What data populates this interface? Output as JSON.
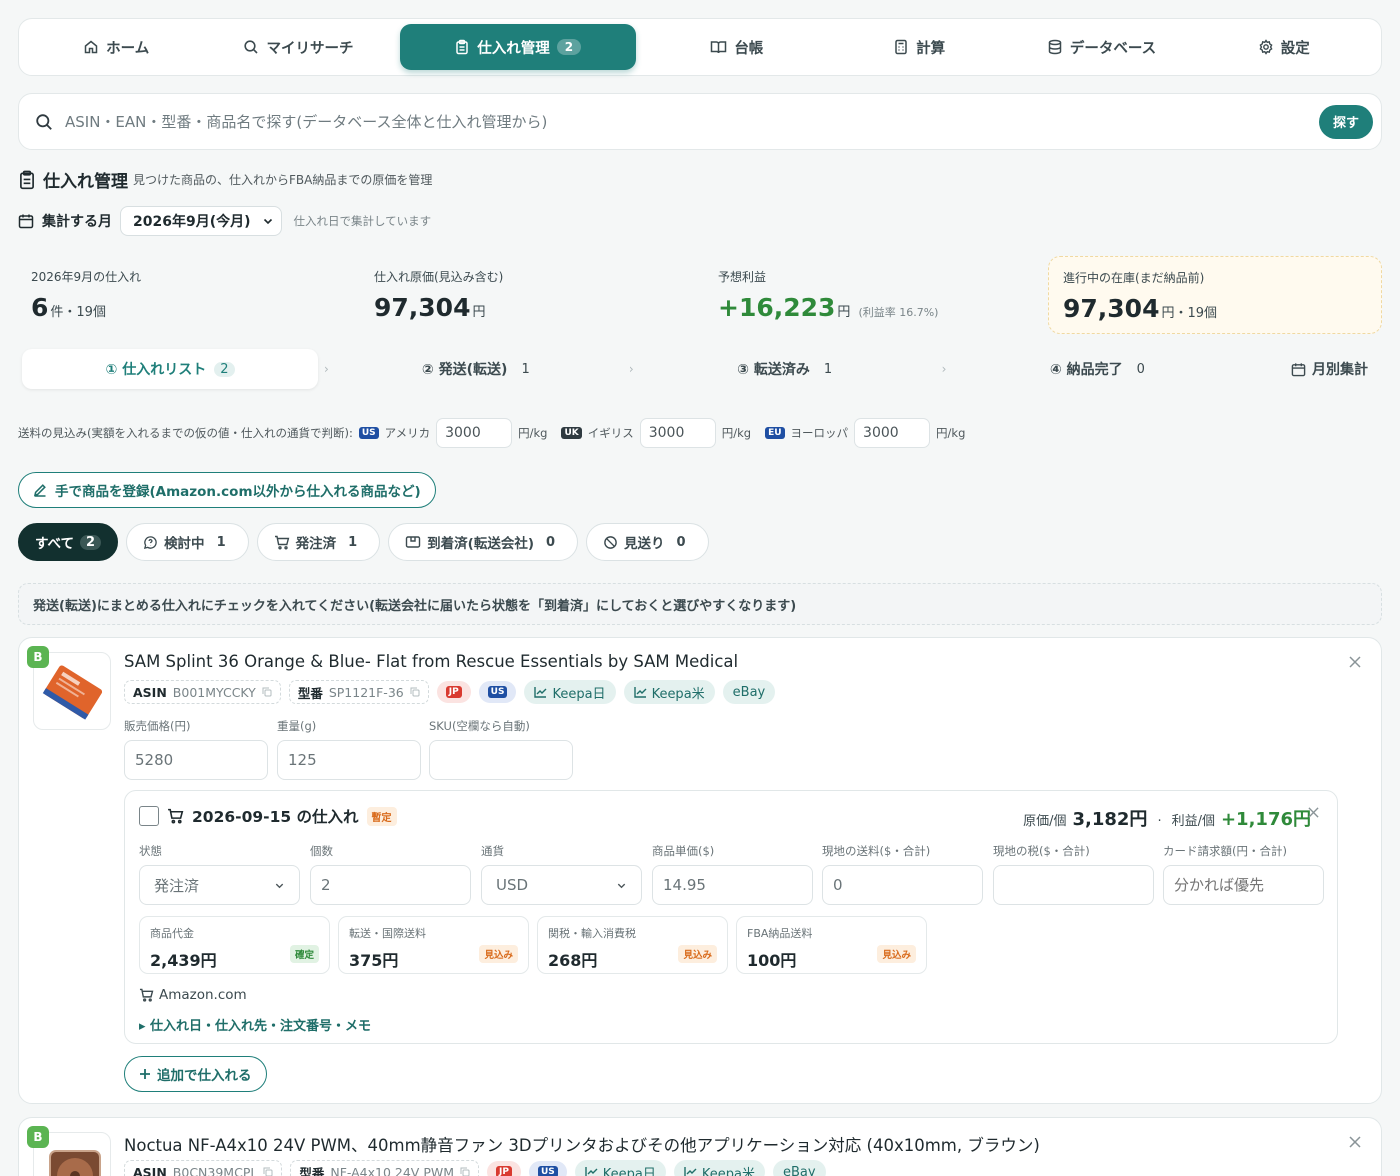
{
  "nav": {
    "home": "ホーム",
    "my_research": "マイリサーチ",
    "purchase": "仕入れ管理",
    "purchase_badge": "2",
    "ledger": "台帳",
    "calc": "計算",
    "database": "データベース",
    "settings": "設定"
  },
  "search": {
    "placeholder": "ASIN・EAN・型番・商品名で探す(データベース全体と仕入れ管理から)",
    "button": "探す"
  },
  "heading": {
    "title": "仕入れ管理",
    "subtitle": "見つけた商品の、仕入れからFBA納品までの原価を管理"
  },
  "month": {
    "label": "集計する月",
    "selected": "2026年9月(今月)",
    "note": "仕入れ日で集計しています"
  },
  "stats": {
    "purchases_label": "2026年9月の仕入れ",
    "purchases_count": "6",
    "purchases_unit": "件・19個",
    "cost_label": "仕入れ原価(見込み含む)",
    "cost_value": "97,304",
    "cost_unit": "円",
    "profit_label": "予想利益",
    "profit_value": "+16,223",
    "profit_unit": "円",
    "profit_rate": "(利益率 16.7%)",
    "stock_label": "進行中の在庫(まだ納品前)",
    "stock_value": "97,304",
    "stock_unit": "円・19個"
  },
  "steps": {
    "s1": "① 仕入れリスト",
    "s1_count": "2",
    "s2": "② 発送(転送)",
    "s2_count": "1",
    "s3": "③ 転送済み",
    "s3_count": "1",
    "s4": "④ 納品完了",
    "s4_count": "0",
    "monthly": "月別集計"
  },
  "shipping": {
    "label": "送料の見込み(実額を入れるまでの仮の値・仕入れの通貨で判断):",
    "us_flag": "US",
    "us_name": "アメリカ",
    "us_value": "3000",
    "uk_flag": "UK",
    "uk_name": "イギリス",
    "uk_value": "3000",
    "eu_flag": "EU",
    "eu_name": "ヨーロッパ",
    "eu_value": "3000",
    "unit": "円/kg"
  },
  "manual_button": "手で商品を登録(Amazon.com以外から仕入れる商品など)",
  "filters": {
    "all": "すべて",
    "all_count": "2",
    "review": "検討中",
    "review_count": "1",
    "ordered": "発注済",
    "ordered_count": "1",
    "arrived": "到着済(転送会社)",
    "arrived_count": "0",
    "skip": "見送り",
    "skip_count": "0"
  },
  "info_text": "発送(転送)にまとめる仕入れにチェックを入れてください(転送会社に届いたら状態を「到着済」にしておくと選びやすくなります)",
  "product1": {
    "rank": "B",
    "title": "SAM Splint 36 Orange & Blue- Flat from Rescue Essentials by SAM Medical",
    "asin_label": "ASIN",
    "asin": "B001MYCCKY",
    "model_label": "型番",
    "model": "SP1121F-36",
    "jp": "JP",
    "us": "US",
    "keepa_jp": "Keepa日",
    "keepa_us": "Keepa米",
    "ebay": "eBay",
    "price_label": "販売価格(円)",
    "price": "5280",
    "weight_label": "重量(g)",
    "weight": "125",
    "sku_label": "SKU(空欄なら自動)",
    "sku": "",
    "purchase": {
      "date": "2026-09-15 の仕入れ",
      "tentative": "暫定",
      "cost_label": "原価/個",
      "cost": "3,182円",
      "profit_label": "利益/個",
      "profit": "+1,176円",
      "status_label": "状態",
      "status": "発注済",
      "qty_label": "個数",
      "qty": "2",
      "currency_label": "通貨",
      "currency": "USD",
      "unit_price_label": "商品単価($)",
      "unit_price": "14.95",
      "local_ship_label": "現地の送料($・合計)",
      "local_ship": "0",
      "local_tax_label": "現地の税($・合計)",
      "local_tax": "",
      "card_label": "カード請求額(円・合計)",
      "card_placeholder": "分かれば優先",
      "item_cost_label": "商品代金",
      "item_cost": "2,439円",
      "item_cost_tag": "確定",
      "fwd_label": "転送・国際送料",
      "fwd": "375円",
      "fwd_tag": "見込み",
      "duty_label": "関税・輸入消費税",
      "duty": "268円",
      "duty_tag": "見込み",
      "fba_label": "FBA納品送料",
      "fba": "100円",
      "fba_tag": "見込み",
      "store": "Amazon.com",
      "details": "▸ 仕入れ日・仕入れ先・注文番号・メモ"
    },
    "add_button": "追加で仕入れる"
  },
  "product2": {
    "rank": "B",
    "title": "Noctua NF-A4x10 24V PWM、40mm静音ファン 3Dプリンタおよびその他アプリケーション対応 (40x10mm, ブラウン)",
    "asin_label": "ASIN",
    "asin": "B0CN39MCPL",
    "model_label": "型番",
    "model": "NF-A4x10 24V PWM",
    "jp": "JP",
    "us": "US",
    "keepa_jp": "Keepa日",
    "keepa_us": "Keepa米",
    "ebay": "eBay"
  }
}
